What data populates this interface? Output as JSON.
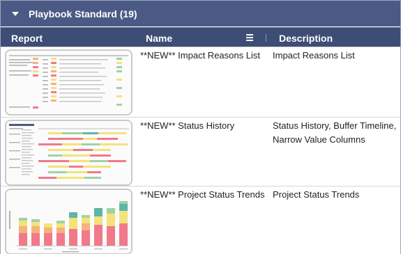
{
  "group": {
    "title": "Playbook Standard (19)"
  },
  "columns": {
    "report": "Report",
    "name": "Name",
    "description": "Description"
  },
  "rows": [
    {
      "name": "**NEW** Impact Reasons List",
      "description": "Impact Reasons List"
    },
    {
      "name": "**NEW** Status History",
      "description": "Status History, Buffer Timeline, Narrow Value Columns"
    },
    {
      "name": "**NEW** Project Status Trends",
      "description": "Project Status Trends"
    }
  ],
  "colors": {
    "group_header": "#4a5a84",
    "column_header": "#3e4d76",
    "accent_red": "#f07a8a",
    "accent_yellow": "#f3e37a",
    "accent_green": "#9fd3a5",
    "accent_teal": "#5db6a8",
    "accent_orange": "#f4b27d"
  },
  "icons": {
    "expand": "chevron-down-icon",
    "column_menu": "hamburger-icon"
  }
}
